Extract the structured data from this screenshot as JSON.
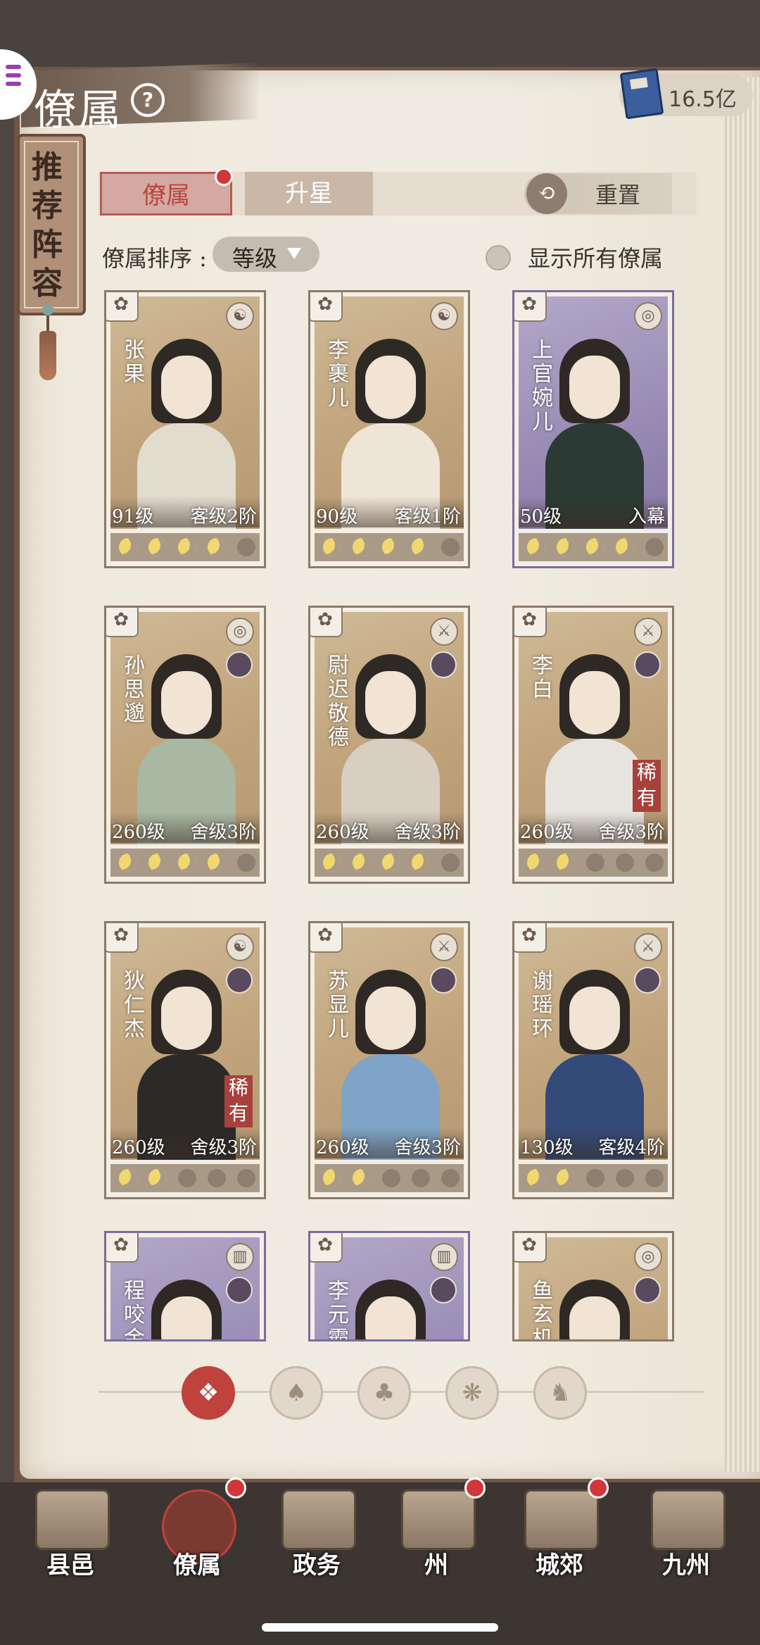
{
  "header": {
    "title": "僚属",
    "currency_value": "16.5亿"
  },
  "recommend_banner": "推荐阵容",
  "tabs": [
    {
      "label": "僚属",
      "active": true,
      "badge": true
    },
    {
      "label": "升星",
      "active": false,
      "badge": false
    }
  ],
  "reset_label": "重置",
  "sort": {
    "label": "僚属排序 :",
    "value": "等级"
  },
  "show_all_label": "显示所有僚属",
  "cards": [
    {
      "name": "张果",
      "level": "91级",
      "rank": "客级2阶",
      "stars_on": 4,
      "theme": "tan",
      "robe": "#e2dccf",
      "type_icon": "☯",
      "rare": ""
    },
    {
      "name": "李裹儿",
      "level": "90级",
      "rank": "客级1阶",
      "stars_on": 4,
      "theme": "tan",
      "robe": "#efe5d6",
      "type_icon": "☯",
      "rare": ""
    },
    {
      "name": "上官婉儿",
      "level": "50级",
      "rank": "入幕",
      "stars_on": 4,
      "theme": "purple",
      "robe": "#2b3a34",
      "type_icon": "◎",
      "rare": ""
    },
    {
      "name": "孙思邈",
      "level": "260级",
      "rank": "舍级3阶",
      "stars_on": 4,
      "theme": "tan",
      "robe": "#a9b8a2",
      "type_icon": "◎",
      "rare": ""
    },
    {
      "name": "尉迟敬德",
      "level": "260级",
      "rank": "舍级3阶",
      "stars_on": 4,
      "theme": "tan",
      "robe": "#d8cfc2",
      "type_icon": "⚔",
      "rare": ""
    },
    {
      "name": "李白",
      "level": "260级",
      "rank": "舍级3阶",
      "stars_on": 2,
      "theme": "tan",
      "robe": "#e7e4e0",
      "type_icon": "⚔",
      "rare": "稀有"
    },
    {
      "name": "狄仁杰",
      "level": "260级",
      "rank": "舍级3阶",
      "stars_on": 2,
      "theme": "tan",
      "robe": "#2b2a28",
      "type_icon": "☯",
      "rare": "稀有"
    },
    {
      "name": "苏显儿",
      "level": "260级",
      "rank": "舍级3阶",
      "stars_on": 2,
      "theme": "tan",
      "robe": "#7fa4c8",
      "type_icon": "⚔",
      "rare": ""
    },
    {
      "name": "谢瑶环",
      "level": "130级",
      "rank": "客级4阶",
      "stars_on": 2,
      "theme": "tan",
      "robe": "#344a78",
      "type_icon": "⚔",
      "rare": ""
    },
    {
      "name": "程咬金",
      "level": "",
      "rank": "",
      "stars_on": 0,
      "theme": "purple",
      "robe": "#5b4a3e",
      "type_icon": "▥",
      "rare": ""
    },
    {
      "name": "李元霸",
      "level": "",
      "rank": "",
      "stars_on": 0,
      "theme": "purple",
      "robe": "#8a5a3c",
      "type_icon": "▥",
      "rare": ""
    },
    {
      "name": "鱼玄机",
      "level": "",
      "rank": "",
      "stars_on": 0,
      "theme": "tan",
      "robe": "#e6ddd2",
      "type_icon": "◎",
      "rare": ""
    }
  ],
  "filters": [
    "all-filter-icon",
    "bell-filter-icon",
    "cat-filter-icon",
    "fan-filter-icon",
    "horse-filter-icon"
  ],
  "bottom_nav": [
    {
      "label": "县邑",
      "badge": false,
      "active": false
    },
    {
      "label": "僚属",
      "badge": true,
      "active": true
    },
    {
      "label": "政务",
      "badge": false,
      "active": false
    },
    {
      "label": "州",
      "badge": true,
      "active": false
    },
    {
      "label": "城郊",
      "badge": true,
      "active": false
    },
    {
      "label": "九州",
      "badge": false,
      "active": false
    }
  ],
  "colors": {
    "accent": "#c0423c",
    "book_page": "#f1ece2",
    "purple_card": "#978bb4",
    "tan_card": "#c1a47c"
  }
}
